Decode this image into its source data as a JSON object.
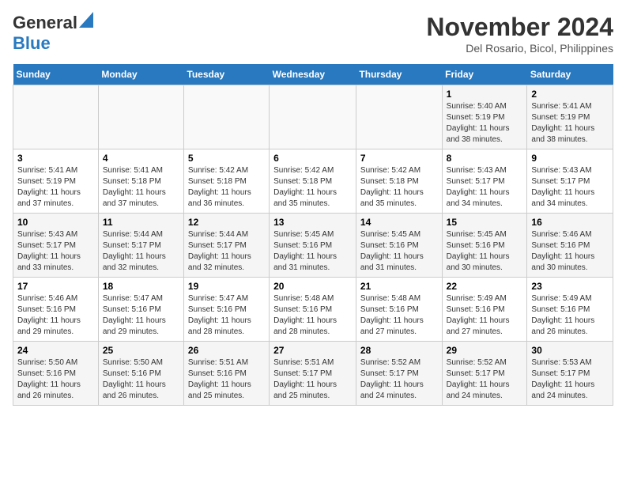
{
  "logo": {
    "line1": "General",
    "line2": "Blue"
  },
  "title": "November 2024",
  "subtitle": "Del Rosario, Bicol, Philippines",
  "weekdays": [
    "Sunday",
    "Monday",
    "Tuesday",
    "Wednesday",
    "Thursday",
    "Friday",
    "Saturday"
  ],
  "weeks": [
    [
      {
        "day": "",
        "info": ""
      },
      {
        "day": "",
        "info": ""
      },
      {
        "day": "",
        "info": ""
      },
      {
        "day": "",
        "info": ""
      },
      {
        "day": "",
        "info": ""
      },
      {
        "day": "1",
        "info": "Sunrise: 5:40 AM\nSunset: 5:19 PM\nDaylight: 11 hours and 38 minutes."
      },
      {
        "day": "2",
        "info": "Sunrise: 5:41 AM\nSunset: 5:19 PM\nDaylight: 11 hours and 38 minutes."
      }
    ],
    [
      {
        "day": "3",
        "info": "Sunrise: 5:41 AM\nSunset: 5:19 PM\nDaylight: 11 hours and 37 minutes."
      },
      {
        "day": "4",
        "info": "Sunrise: 5:41 AM\nSunset: 5:18 PM\nDaylight: 11 hours and 37 minutes."
      },
      {
        "day": "5",
        "info": "Sunrise: 5:42 AM\nSunset: 5:18 PM\nDaylight: 11 hours and 36 minutes."
      },
      {
        "day": "6",
        "info": "Sunrise: 5:42 AM\nSunset: 5:18 PM\nDaylight: 11 hours and 35 minutes."
      },
      {
        "day": "7",
        "info": "Sunrise: 5:42 AM\nSunset: 5:18 PM\nDaylight: 11 hours and 35 minutes."
      },
      {
        "day": "8",
        "info": "Sunrise: 5:43 AM\nSunset: 5:17 PM\nDaylight: 11 hours and 34 minutes."
      },
      {
        "day": "9",
        "info": "Sunrise: 5:43 AM\nSunset: 5:17 PM\nDaylight: 11 hours and 34 minutes."
      }
    ],
    [
      {
        "day": "10",
        "info": "Sunrise: 5:43 AM\nSunset: 5:17 PM\nDaylight: 11 hours and 33 minutes."
      },
      {
        "day": "11",
        "info": "Sunrise: 5:44 AM\nSunset: 5:17 PM\nDaylight: 11 hours and 32 minutes."
      },
      {
        "day": "12",
        "info": "Sunrise: 5:44 AM\nSunset: 5:17 PM\nDaylight: 11 hours and 32 minutes."
      },
      {
        "day": "13",
        "info": "Sunrise: 5:45 AM\nSunset: 5:16 PM\nDaylight: 11 hours and 31 minutes."
      },
      {
        "day": "14",
        "info": "Sunrise: 5:45 AM\nSunset: 5:16 PM\nDaylight: 11 hours and 31 minutes."
      },
      {
        "day": "15",
        "info": "Sunrise: 5:45 AM\nSunset: 5:16 PM\nDaylight: 11 hours and 30 minutes."
      },
      {
        "day": "16",
        "info": "Sunrise: 5:46 AM\nSunset: 5:16 PM\nDaylight: 11 hours and 30 minutes."
      }
    ],
    [
      {
        "day": "17",
        "info": "Sunrise: 5:46 AM\nSunset: 5:16 PM\nDaylight: 11 hours and 29 minutes."
      },
      {
        "day": "18",
        "info": "Sunrise: 5:47 AM\nSunset: 5:16 PM\nDaylight: 11 hours and 29 minutes."
      },
      {
        "day": "19",
        "info": "Sunrise: 5:47 AM\nSunset: 5:16 PM\nDaylight: 11 hours and 28 minutes."
      },
      {
        "day": "20",
        "info": "Sunrise: 5:48 AM\nSunset: 5:16 PM\nDaylight: 11 hours and 28 minutes."
      },
      {
        "day": "21",
        "info": "Sunrise: 5:48 AM\nSunset: 5:16 PM\nDaylight: 11 hours and 27 minutes."
      },
      {
        "day": "22",
        "info": "Sunrise: 5:49 AM\nSunset: 5:16 PM\nDaylight: 11 hours and 27 minutes."
      },
      {
        "day": "23",
        "info": "Sunrise: 5:49 AM\nSunset: 5:16 PM\nDaylight: 11 hours and 26 minutes."
      }
    ],
    [
      {
        "day": "24",
        "info": "Sunrise: 5:50 AM\nSunset: 5:16 PM\nDaylight: 11 hours and 26 minutes."
      },
      {
        "day": "25",
        "info": "Sunrise: 5:50 AM\nSunset: 5:16 PM\nDaylight: 11 hours and 26 minutes."
      },
      {
        "day": "26",
        "info": "Sunrise: 5:51 AM\nSunset: 5:16 PM\nDaylight: 11 hours and 25 minutes."
      },
      {
        "day": "27",
        "info": "Sunrise: 5:51 AM\nSunset: 5:17 PM\nDaylight: 11 hours and 25 minutes."
      },
      {
        "day": "28",
        "info": "Sunrise: 5:52 AM\nSunset: 5:17 PM\nDaylight: 11 hours and 24 minutes."
      },
      {
        "day": "29",
        "info": "Sunrise: 5:52 AM\nSunset: 5:17 PM\nDaylight: 11 hours and 24 minutes."
      },
      {
        "day": "30",
        "info": "Sunrise: 5:53 AM\nSunset: 5:17 PM\nDaylight: 11 hours and 24 minutes."
      }
    ]
  ]
}
